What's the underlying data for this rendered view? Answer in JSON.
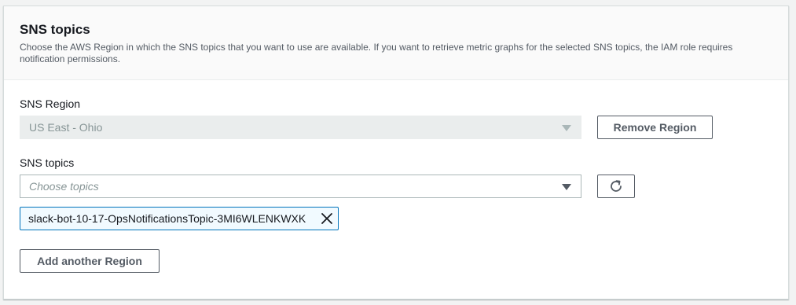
{
  "section": {
    "title": "SNS topics",
    "description": "Choose the AWS Region in which the SNS topics that you want to use are available. If you want to retrieve metric graphs for the selected SNS topics, the IAM role requires notification permissions."
  },
  "region_field": {
    "label": "SNS Region",
    "value": "US East - Ohio",
    "disabled": true
  },
  "remove_region_button": "Remove Region",
  "topics_field": {
    "label": "SNS topics",
    "placeholder": "Choose topics"
  },
  "selected_topics": [
    "slack-bot-10-17-OpsNotificationsTopic-3MI6WLENKWXK"
  ],
  "add_region_button": "Add another Region"
}
